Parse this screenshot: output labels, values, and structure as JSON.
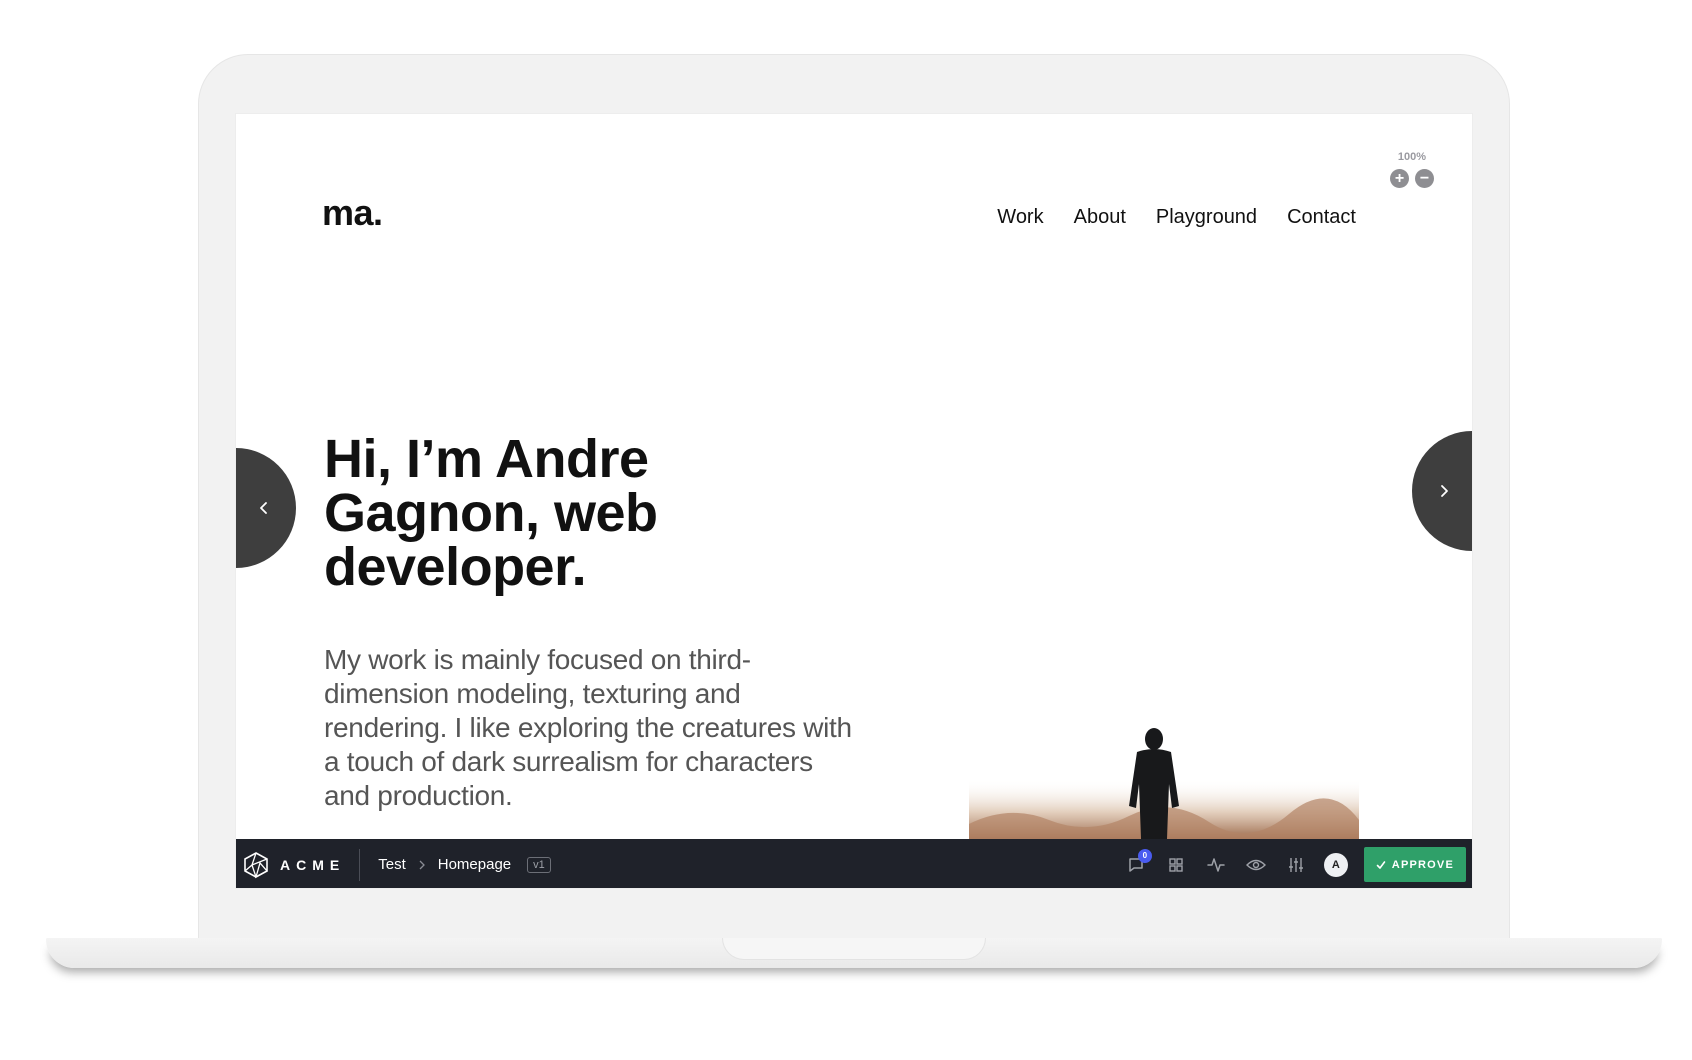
{
  "site": {
    "logo": "ma.",
    "nav": [
      "Work",
      "About",
      "Playground",
      "Contact"
    ],
    "zoom_label": "100%",
    "zoom_in_symbol": "+",
    "zoom_out_symbol": "−"
  },
  "hero": {
    "title": "Hi, I’m Andre Gagnon, web developer.",
    "description": "My work is mainly focused on third-dimension modeling, texturing and rendering. I like exploring the creatures with a touch of dark surrealism for characters and production."
  },
  "toolbar": {
    "brand": "ACME",
    "breadcrumb": [
      "Test",
      "Homepage"
    ],
    "version": "v1",
    "comment_count": "0",
    "avatar_initial": "A",
    "approve_label": "APPROVE",
    "icons": [
      "comment-icon",
      "grid-icon",
      "activity-icon",
      "eye-icon",
      "sliders-icon"
    ]
  },
  "colors": {
    "toolbar_bg": "#1f222a",
    "approve_green": "#2fa069",
    "badge_blue": "#4a5cf0",
    "slider_button": "#3e3e3e"
  }
}
